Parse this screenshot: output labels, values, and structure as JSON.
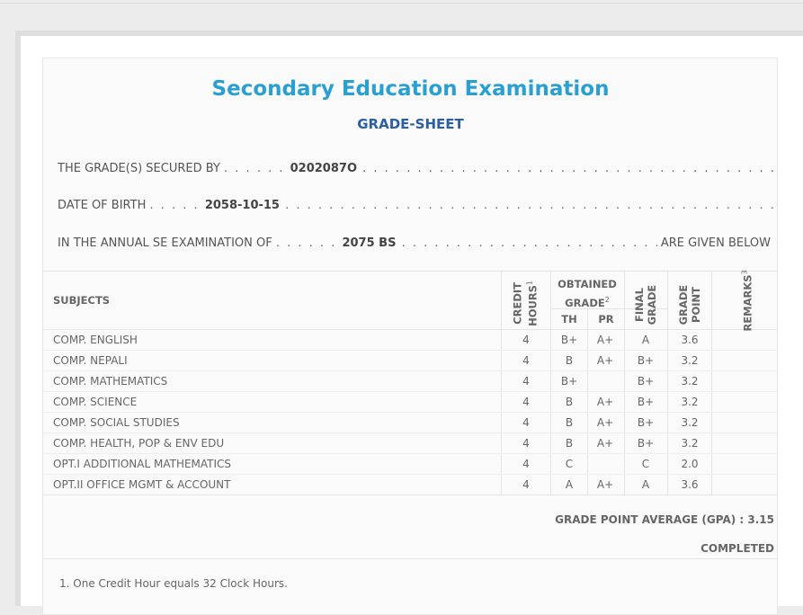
{
  "header": {
    "title": "Secondary Education Examination",
    "subtitle": "GRADE-SHEET"
  },
  "info": {
    "secured_by_label": "THE GRADE(S) SECURED BY",
    "symbol_no": "0202087O",
    "dob_label": "DATE OF BIRTH",
    "dob": "2058-10-15",
    "exam_label": "IN THE ANNUAL SE EXAMINATION OF",
    "exam_year": "2075 BS",
    "exam_suffix": "ARE GIVEN BELOW"
  },
  "table": {
    "headers": {
      "subjects": "SUBJECTS",
      "credit_hours": "CREDIT HOURS",
      "credit_sup": "1",
      "obtained_grade": "OBTAINED GRADE",
      "obtained_sup": "2",
      "th": "TH",
      "pr": "PR",
      "final_grade": "FINAL GRADE",
      "grade_point": "GRADE POINT",
      "remarks": "REMARKS",
      "remarks_sup": "3"
    },
    "rows": [
      {
        "subject": "COMP. ENGLISH",
        "credit": "4",
        "th": "B+",
        "pr": "A+",
        "final": "A",
        "gp": "3.6"
      },
      {
        "subject": "COMP. NEPALI",
        "credit": "4",
        "th": "B",
        "pr": "A+",
        "final": "B+",
        "gp": "3.2"
      },
      {
        "subject": "COMP. MATHEMATICS",
        "credit": "4",
        "th": "B+",
        "pr": "",
        "final": "B+",
        "gp": "3.2"
      },
      {
        "subject": "COMP. SCIENCE",
        "credit": "4",
        "th": "B",
        "pr": "A+",
        "final": "B+",
        "gp": "3.2"
      },
      {
        "subject": "COMP. SOCIAL STUDIES",
        "credit": "4",
        "th": "B",
        "pr": "A+",
        "final": "B+",
        "gp": "3.2"
      },
      {
        "subject": "COMP. HEALTH, POP & ENV EDU",
        "credit": "4",
        "th": "B",
        "pr": "A+",
        "final": "B+",
        "gp": "3.2"
      },
      {
        "subject": "OPT.I ADDITIONAL MATHEMATICS",
        "credit": "4",
        "th": "C",
        "pr": "",
        "final": "C",
        "gp": "2.0"
      },
      {
        "subject": "OPT.II OFFICE MGMT & ACCOUNT",
        "credit": "4",
        "th": "A",
        "pr": "A+",
        "final": "A",
        "gp": "3.6"
      }
    ]
  },
  "summary": {
    "gpa_text": "GRADE POINT AVERAGE (GPA) : 3.15",
    "status": "COMPLETED"
  },
  "footnote": "1. One Credit Hour equals 32 Clock Hours."
}
